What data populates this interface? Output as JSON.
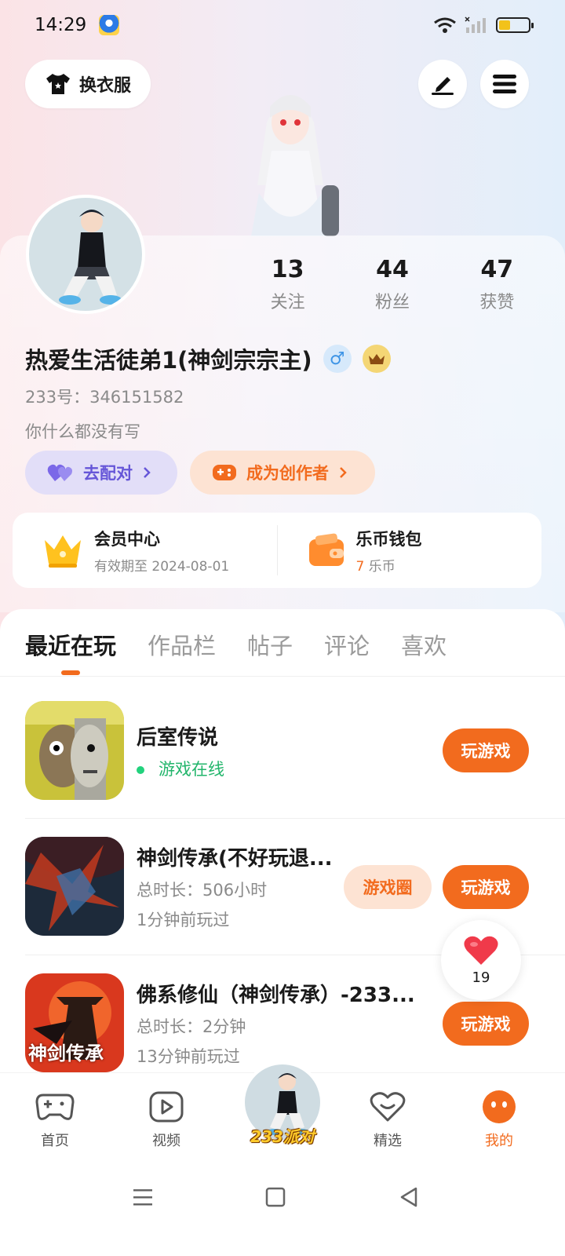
{
  "status_bar": {
    "time": "14:29"
  },
  "header": {
    "outfit_label": "换衣服"
  },
  "profile": {
    "stats": [
      {
        "value": "13",
        "label": "关注"
      },
      {
        "value": "44",
        "label": "粉丝"
      },
      {
        "value": "47",
        "label": "获赞"
      }
    ],
    "nickname": "热爱生活徒弟1(神剑宗宗主)",
    "gender_symbol": "♂",
    "uid": "233号：346151582",
    "bio": "你什么都没有写",
    "match_label": "去配对",
    "creator_label": "成为创作者"
  },
  "membership": {
    "vip_title": "会员中心",
    "vip_sub": "有效期至 2024-08-01",
    "wallet_title": "乐币钱包",
    "wallet_amount": "7",
    "wallet_unit": "乐币"
  },
  "tabs": [
    {
      "label": "最近在玩",
      "active": true
    },
    {
      "label": "作品栏"
    },
    {
      "label": "帖子"
    },
    {
      "label": "评论"
    },
    {
      "label": "喜欢"
    }
  ],
  "games": [
    {
      "title": "后室传说",
      "status": "游戏在线",
      "play_label": "玩游戏"
    },
    {
      "title": "神剑传承(不好玩退...",
      "duration": "总时长：506小时",
      "last_played": "1分钟前玩过",
      "circle_label": "游戏圈",
      "play_label": "玩游戏"
    },
    {
      "title": "佛系修仙（神剑传承）-233...",
      "duration": "总时长：2分钟",
      "last_played": "13分钟前玩过",
      "thumb_text": "神剑传承",
      "play_label": "玩游戏"
    }
  ],
  "like_float": {
    "count": "19"
  },
  "bottom_nav": {
    "home": "首页",
    "video": "视频",
    "center": "233派对",
    "featured": "精选",
    "mine": "我的"
  },
  "colors": {
    "accent": "#f26b1e",
    "online": "#22b56b",
    "match": "#6656d8"
  }
}
